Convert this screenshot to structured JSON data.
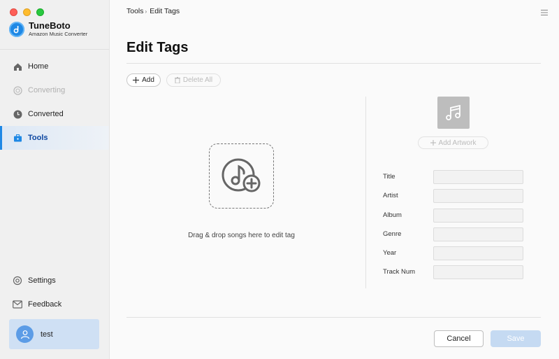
{
  "app": {
    "name": "TuneBoto",
    "subtitle": "Amazon Music Converter"
  },
  "sidebar": {
    "items": [
      {
        "label": "Home",
        "icon": "home-icon",
        "state": "normal"
      },
      {
        "label": "Converting",
        "icon": "sync-icon",
        "state": "disabled"
      },
      {
        "label": "Converted",
        "icon": "clock-icon",
        "state": "normal"
      },
      {
        "label": "Tools",
        "icon": "toolbox-icon",
        "state": "active"
      }
    ],
    "bottom_items": [
      {
        "label": "Settings",
        "icon": "gear-icon"
      },
      {
        "label": "Feedback",
        "icon": "mail-icon"
      }
    ],
    "user": {
      "name": "test"
    }
  },
  "breadcrumb": {
    "parent": "Tools",
    "separator": "›",
    "current": "Edit Tags"
  },
  "page": {
    "title": "Edit Tags"
  },
  "toolbar": {
    "add_label": "Add",
    "delete_all_label": "Delete All"
  },
  "dropzone": {
    "text": "Drag & drop songs here to edit tag"
  },
  "artwork": {
    "add_label": "Add Artwork"
  },
  "fields": [
    {
      "label": "Title",
      "value": ""
    },
    {
      "label": "Artist",
      "value": ""
    },
    {
      "label": "Album",
      "value": ""
    },
    {
      "label": "Genre",
      "value": ""
    },
    {
      "label": "Year",
      "value": ""
    },
    {
      "label": "Track Num",
      "value": ""
    }
  ],
  "actions": {
    "cancel_label": "Cancel",
    "save_label": "Save"
  },
  "colors": {
    "accent": "#1e88e5",
    "active_bg": "#dde8f5",
    "save_disabled": "#c5daf2",
    "user_card": "#cfe0f4"
  }
}
